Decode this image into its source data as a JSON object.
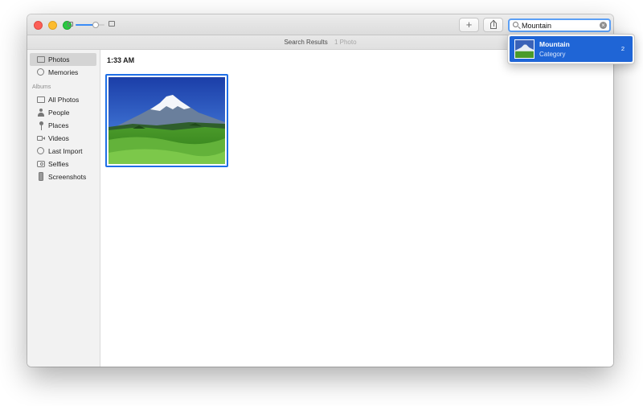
{
  "toolbar": {
    "add_label": "+",
    "search_value": "Mountain",
    "search_clear": "×",
    "zoom_level": 0.7
  },
  "results_bar": {
    "title": "Search Results",
    "count": "1 Photo"
  },
  "sidebar": {
    "top_items": [
      {
        "label": "Photos",
        "icon": "photos-icon",
        "selected": true
      },
      {
        "label": "Memories",
        "icon": "memories-icon",
        "selected": false
      }
    ],
    "section_label": "Albums",
    "albums": [
      {
        "label": "All Photos",
        "icon": "all-photos-icon"
      },
      {
        "label": "People",
        "icon": "people-icon"
      },
      {
        "label": "Places",
        "icon": "places-pin-icon"
      },
      {
        "label": "Videos",
        "icon": "videos-camera-icon"
      },
      {
        "label": "Last Import",
        "icon": "last-import-clock-icon"
      },
      {
        "label": "Selfies",
        "icon": "selfies-camera-icon"
      },
      {
        "label": "Screenshots",
        "icon": "screenshots-phone-icon"
      }
    ]
  },
  "content": {
    "time_header": "1:33 AM"
  },
  "suggestion": {
    "title": "Mountain",
    "subtitle": "Category",
    "count": "2"
  },
  "colors": {
    "accent": "#1f65d6",
    "search_focus": "#5b9ff5"
  }
}
